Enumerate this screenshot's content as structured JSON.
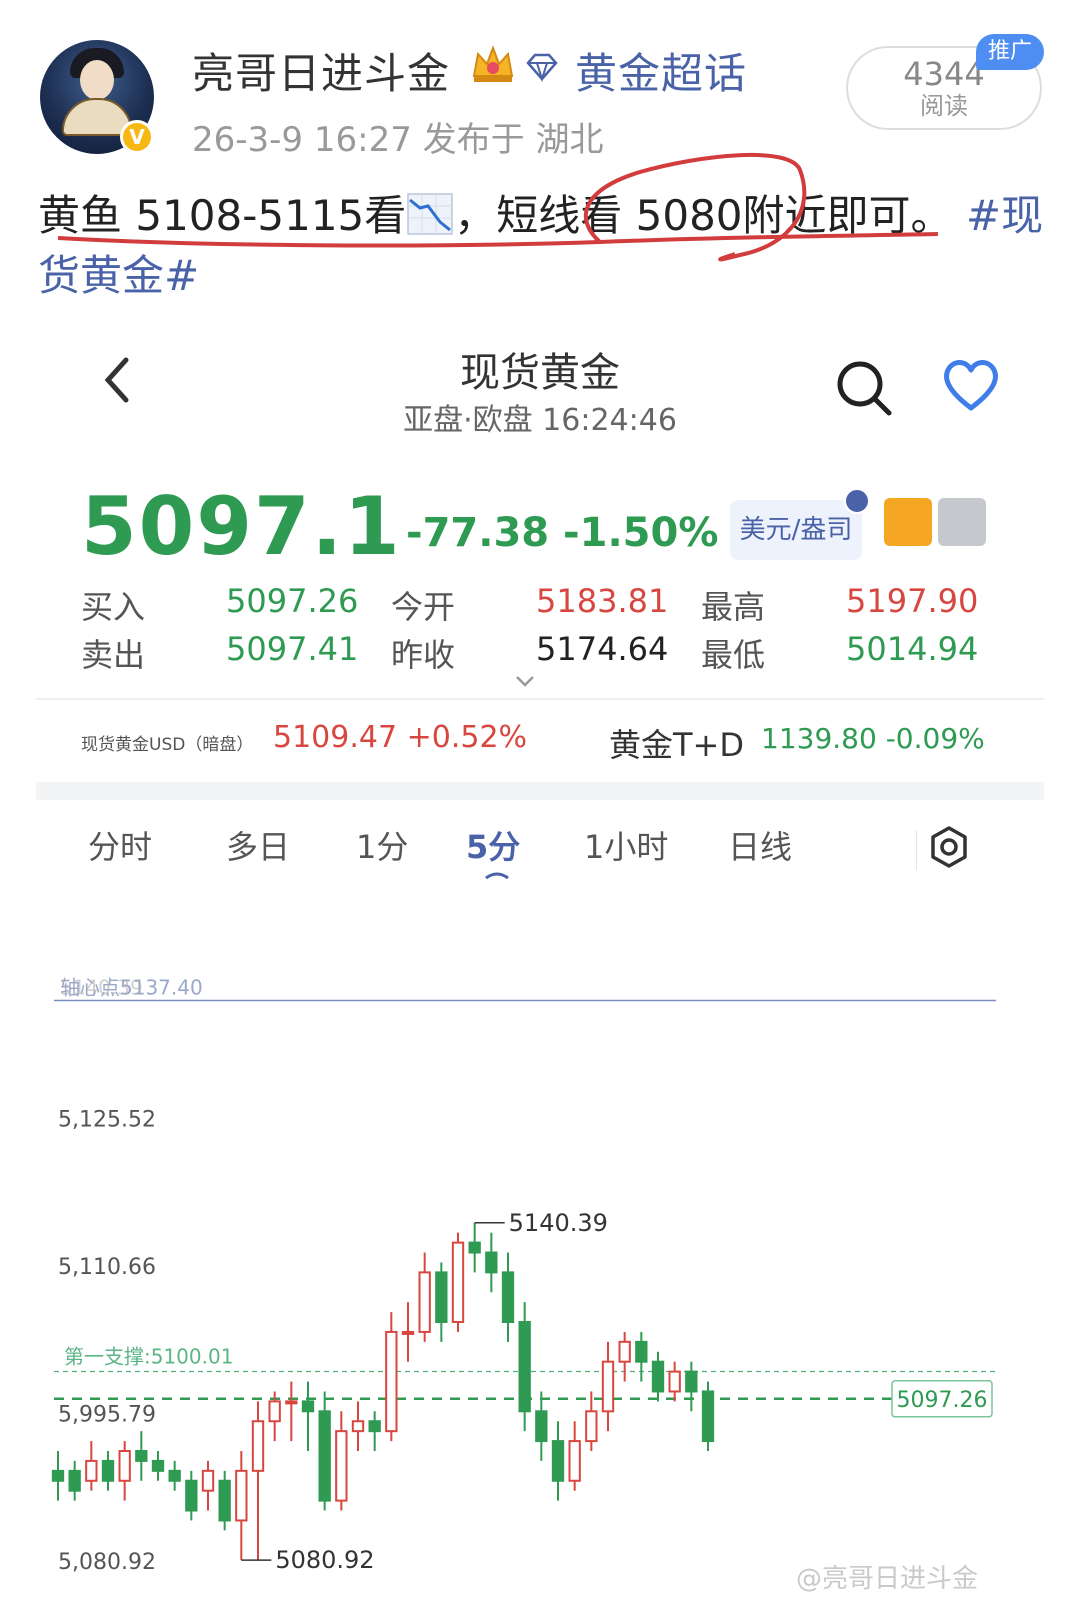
{
  "post": {
    "username": "亮哥日进斗金",
    "topic": "黄金超话",
    "meta": "26-3-9 16:27  发布于 湖北",
    "read_count": "4344",
    "read_label": "阅读",
    "promo_badge": "推广",
    "verified_mark": "V",
    "text_part1": "黄鱼 5108-5115看",
    "text_part2": "，短线看 5080附近即可。",
    "hashtag": "#现货黄金#",
    "icons": [
      "crown-icon",
      "diamond-icon",
      "chart-down-icon"
    ]
  },
  "app": {
    "title": "现货黄金",
    "subtitle": "亚盘·欧盘   16:24:46",
    "price": "5097.1",
    "change": "-77.38  -1.50%",
    "unit_chip": "美元/盎司",
    "quotes": {
      "buy_label": "买入",
      "buy_value": "5097.26",
      "sell_label": "卖出",
      "sell_value": "5097.41",
      "open_label": "今开",
      "open_value": "5183.81",
      "prev_close_label": "昨收",
      "prev_close_value": "5174.64",
      "high_label": "最高",
      "high_value": "5197.90",
      "low_label": "最低",
      "low_value": "5014.94"
    },
    "sub_quotes": {
      "left_label": "现货黄金USD（暗盘）",
      "left_value": "5109.47 +0.52%",
      "right_label": "黄金T+D",
      "right_value": "1139.80 -0.09%"
    },
    "tabs": [
      "分时",
      "多日",
      "1分",
      "5分",
      "1小时",
      "日线"
    ],
    "active_tab": "5分",
    "colors": {
      "up": "#d8473f",
      "down": "#2e9a52",
      "accent": "#4a63a8"
    }
  },
  "chart_data": {
    "type": "candlestick",
    "y_ticks": [
      "5,125.52",
      "5,110.66",
      "5,995.79",
      "5,080.92"
    ],
    "y_tick_values": [
      5125.52,
      5110.66,
      5095.79,
      5080.92
    ],
    "ylim": [
      5079,
      5144
    ],
    "max_label": "5140.39",
    "min_label": "5080.92",
    "pivot_label": "轴心点5137.40",
    "pivot_overlay_label": "5140.39",
    "pivot_value": 5137.4,
    "support_label": "第一支撑:5100.01",
    "support_value": 5100.01,
    "current_label": "5097.26",
    "current_value": 5097.26,
    "candles": [
      [
        5090,
        5089,
        5092,
        5087
      ],
      [
        5090,
        5088,
        5091,
        5087
      ],
      [
        5089,
        5091,
        5093,
        5088
      ],
      [
        5091,
        5089,
        5092,
        5088
      ],
      [
        5089,
        5092,
        5093,
        5087
      ],
      [
        5092,
        5091,
        5094,
        5089
      ],
      [
        5091,
        5090,
        5092,
        5089
      ],
      [
        5090,
        5089,
        5091,
        5088
      ],
      [
        5089,
        5086,
        5090,
        5085
      ],
      [
        5088,
        5090,
        5091,
        5086
      ],
      [
        5089,
        5085,
        5090,
        5084
      ],
      [
        5085,
        5090,
        5092,
        5081
      ],
      [
        5090,
        5095,
        5097,
        5081
      ],
      [
        5095,
        5097,
        5098,
        5093
      ],
      [
        5097,
        5097,
        5099,
        5093
      ],
      [
        5097,
        5096,
        5099,
        5092
      ],
      [
        5096,
        5087,
        5098,
        5086
      ],
      [
        5087,
        5094,
        5096,
        5086
      ],
      [
        5094,
        5095,
        5097,
        5092
      ],
      [
        5095,
        5094,
        5096,
        5092
      ],
      [
        5094,
        5104,
        5106,
        5093
      ],
      [
        5104,
        5104,
        5107,
        5101
      ],
      [
        5104,
        5110,
        5112,
        5103
      ],
      [
        5110,
        5105,
        5111,
        5103
      ],
      [
        5105,
        5113,
        5114,
        5104
      ],
      [
        5113,
        5112,
        5115,
        5110
      ],
      [
        5112,
        5110,
        5114,
        5108
      ],
      [
        5110,
        5105,
        5112,
        5103
      ],
      [
        5105,
        5096,
        5107,
        5094
      ],
      [
        5096,
        5093,
        5098,
        5091
      ],
      [
        5093,
        5089,
        5095,
        5087
      ],
      [
        5089,
        5093,
        5095,
        5088
      ],
      [
        5093,
        5096,
        5098,
        5092
      ],
      [
        5096,
        5101,
        5103,
        5094
      ],
      [
        5101,
        5103,
        5104,
        5099
      ],
      [
        5103,
        5101,
        5104,
        5099
      ],
      [
        5101,
        5098,
        5102,
        5097
      ],
      [
        5098,
        5100,
        5101,
        5097
      ],
      [
        5100,
        5098,
        5101,
        5096
      ],
      [
        5098,
        5093,
        5099,
        5092
      ]
    ]
  }
}
